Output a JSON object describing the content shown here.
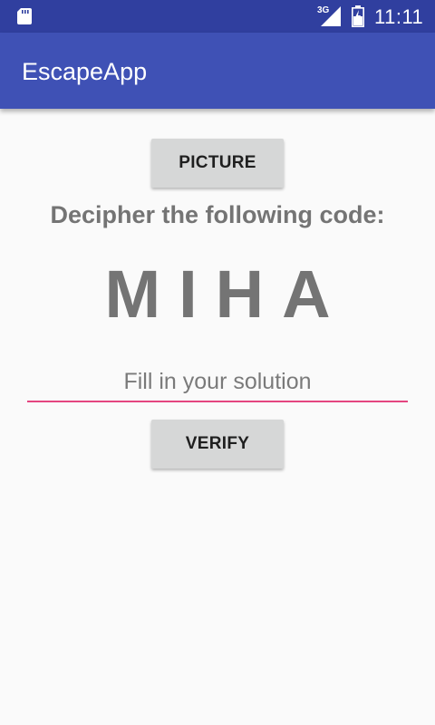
{
  "status_bar": {
    "network": "3G",
    "time": "11:11",
    "icons": [
      "sd-card-icon",
      "signal-icon",
      "battery-icon"
    ]
  },
  "app_bar": {
    "title": "EscapeApp",
    "color": "#3f51b5",
    "status_color": "#303f9f"
  },
  "main": {
    "picture_button_label": "PICTURE",
    "prompt": "Decipher the following code:",
    "code": "MIHA",
    "solution_placeholder": "Fill in your solution",
    "solution_value": "",
    "verify_button_label": "VERIFY",
    "accent_color": "#e4457f"
  }
}
